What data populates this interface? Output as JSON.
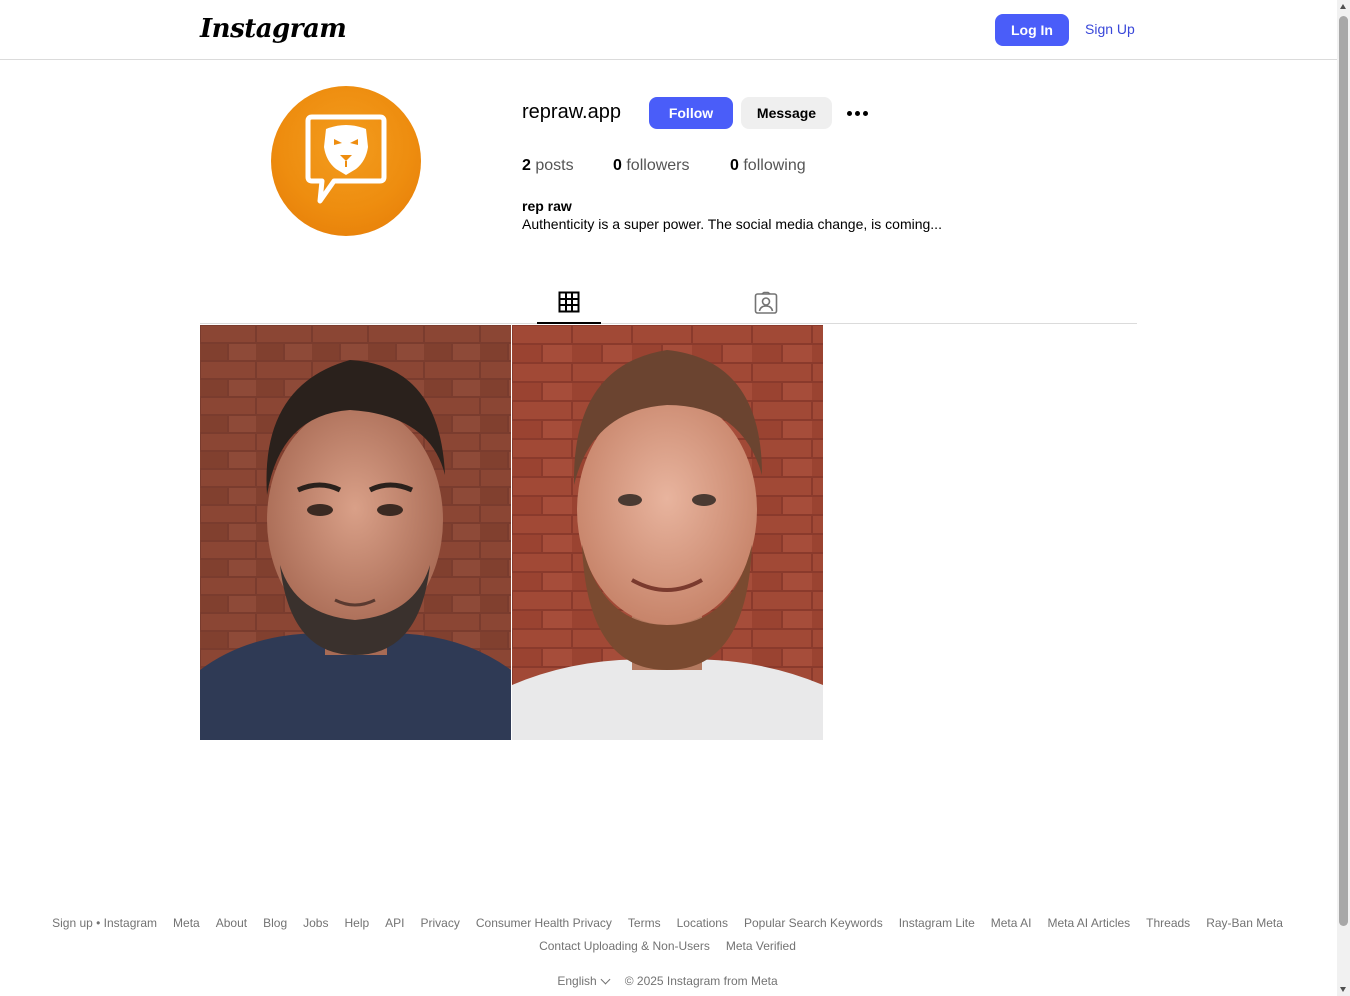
{
  "header": {
    "logo_text": "Instagram",
    "login_label": "Log In",
    "signup_label": "Sign Up"
  },
  "profile": {
    "username": "repraw.app",
    "follow_label": "Follow",
    "message_label": "Message",
    "avatar_icon": "lion-chat-bubble-logo",
    "avatar_color": "#ee8d0f",
    "stats": [
      {
        "num": "2",
        "label": "posts"
      },
      {
        "num": "0",
        "label": "followers"
      },
      {
        "num": "0",
        "label": "following"
      }
    ],
    "full_name": "rep raw",
    "bio": "Authenticity is a super power. The social media change, is coming..."
  },
  "tabs": [
    {
      "icon": "grid-icon",
      "active": true
    },
    {
      "icon": "tagged-icon",
      "active": false
    }
  ],
  "posts": [
    {
      "subject": "man with dark hair and beard in front of brick wall"
    },
    {
      "subject": "man with ginger beard in white t-shirt in front of brick wall"
    }
  ],
  "footer": {
    "row1": [
      "Sign up • Instagram",
      "Meta",
      "About",
      "Blog",
      "Jobs",
      "Help",
      "API",
      "Privacy",
      "Consumer Health Privacy",
      "Terms",
      "Locations",
      "Popular Search Keywords",
      "Instagram Lite",
      "Meta AI",
      "Meta AI Articles",
      "Threads",
      "Ray-Ban Meta"
    ],
    "row2": [
      "Contact Uploading & Non-Users",
      "Meta Verified"
    ],
    "language": "English",
    "copyright": "© 2025 Instagram from Meta"
  },
  "colors": {
    "accent": "#4a5df9",
    "link": "#3947d9",
    "muted": "#737373"
  }
}
